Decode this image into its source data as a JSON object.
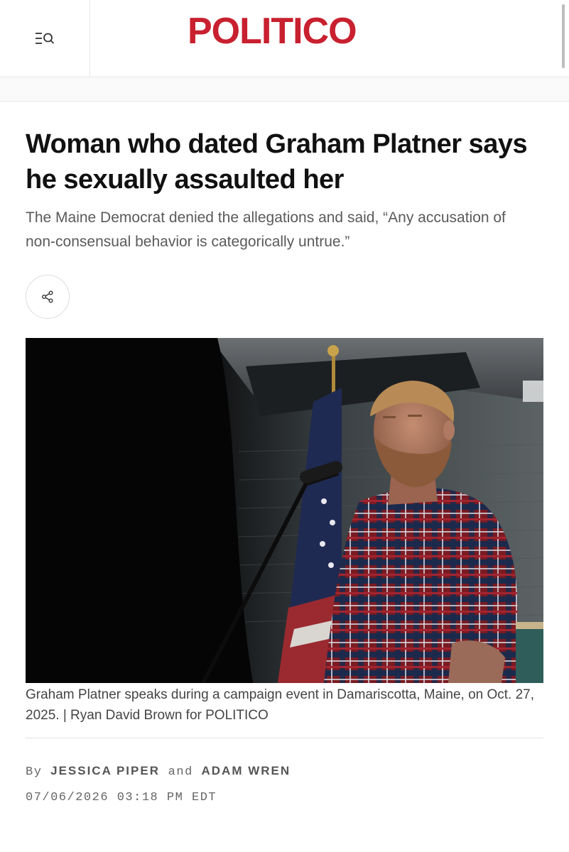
{
  "header": {
    "logo_text": "POLITICO",
    "brand_color": "#c8202f",
    "menu_icon": "menu-search-icon"
  },
  "article": {
    "headline": "Woman who dated Graham Platner says he sexually assaulted her",
    "dek": "The Maine Democrat denied the allegations and said, “Any accusation of non-consensual behavior is categorically untrue.”",
    "share_icon": "share-icon",
    "photo_caption": "Graham Platner speaks during a campaign event in Damariscotta, Maine, on Oct. 27, 2025. | Ryan David Brown for POLITICO",
    "byline": {
      "prefix": "By",
      "author1": "JESSICA PIPER",
      "conjunction": "and",
      "author2": "ADAM WREN"
    },
    "timestamp": "07/06/2026 03:18 PM EDT"
  }
}
